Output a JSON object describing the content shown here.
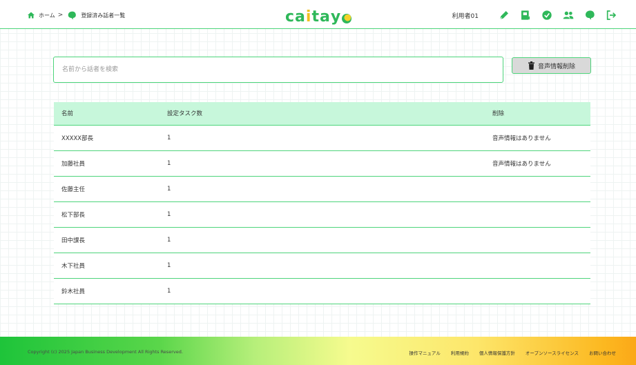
{
  "breadcrumb": {
    "home_label": "ホーム",
    "separator": ">",
    "current_label": "登録済み話者一覧"
  },
  "logo": {
    "letters": [
      "c",
      "a",
      "i",
      "t",
      "a",
      "y"
    ]
  },
  "header": {
    "user_name": "利用者01",
    "icons": [
      "pen-icon",
      "book-icon",
      "check-circle-icon",
      "users-icon",
      "speech-icon",
      "logout-icon"
    ]
  },
  "search": {
    "placeholder": "名前から話者を検索",
    "value": ""
  },
  "toolbar": {
    "delete_label": "音声情報削除"
  },
  "table": {
    "headers": {
      "name": "名前",
      "tasks": "設定タスク数",
      "delete": "削除"
    },
    "rows": [
      {
        "name": "XXXXX部長",
        "tasks": "1",
        "delete": "音声情報はありません"
      },
      {
        "name": "加藤社員",
        "tasks": "1",
        "delete": "音声情報はありません"
      },
      {
        "name": "佐藤主任",
        "tasks": "1",
        "delete": ""
      },
      {
        "name": "松下部長",
        "tasks": "1",
        "delete": ""
      },
      {
        "name": "田中課長",
        "tasks": "1",
        "delete": ""
      },
      {
        "name": "木下社員",
        "tasks": "1",
        "delete": ""
      },
      {
        "name": "鈴木社員",
        "tasks": "1",
        "delete": ""
      }
    ]
  },
  "footer": {
    "copyright": "Copyright (c) 2025 Japan Business Development All Rights Reserved.",
    "links": [
      "操作マニュアル",
      "利用規約",
      "個人情報保護方針",
      "オープンソースライセンス",
      "お問い合わせ"
    ]
  },
  "colors": {
    "accent": "#2fb85a",
    "border": "#4cd47a",
    "table_header_bg": "#c7f7db",
    "logo_yellow": "#f0c020"
  }
}
